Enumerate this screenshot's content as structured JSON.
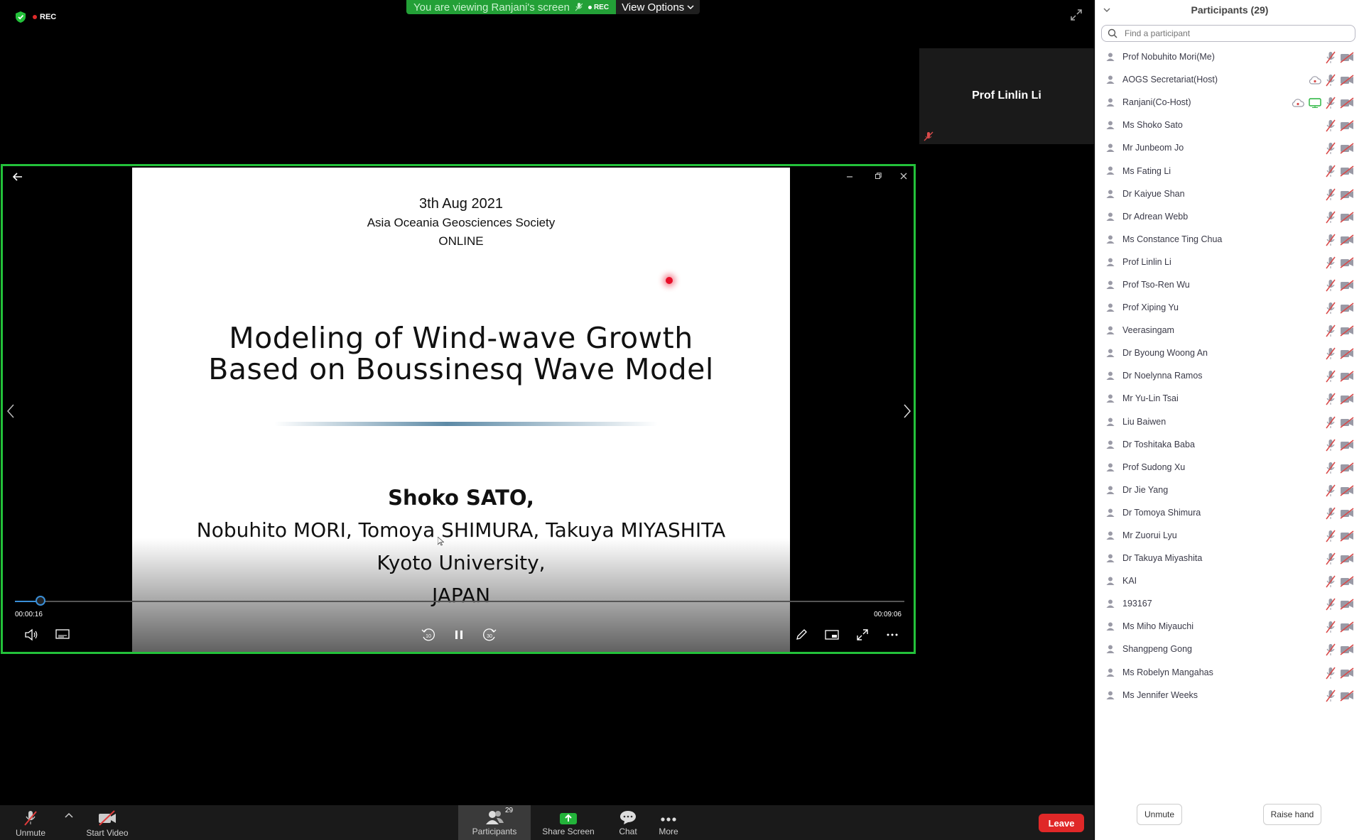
{
  "top_bar": {
    "rec_label": "REC",
    "viewing_text": "You are viewing Ranjani's screen",
    "banner_rec_label": "REC",
    "view_options_label": "View Options"
  },
  "thumbnail": {
    "name": "Prof Linlin Li"
  },
  "slide": {
    "date": "3th Aug 2021",
    "organization": "Asia Oceania Geosciences Society",
    "mode": "ONLINE",
    "title_line1": "Modeling of Wind-wave Growth",
    "title_line2": "Based on Boussinesq Wave Model",
    "presenter": "Shoko SATO,",
    "coauthors": "Nobuhito MORI, Tomoya SHIMURA, Takuya MIYASHITA",
    "university": "Kyoto University,",
    "country": "JAPAN"
  },
  "playback": {
    "current_time": "00:00:16",
    "total_time": "00:09:06",
    "progress": 0.029,
    "rewind_label": "10",
    "forward_label": "30"
  },
  "toolbar": {
    "unmute_label": "Unmute",
    "start_video_label": "Start Video",
    "participants_label": "Participants",
    "participants_count": "29",
    "share_screen_label": "Share Screen",
    "chat_label": "Chat",
    "more_label": "More",
    "leave_label": "Leave"
  },
  "panel": {
    "title": "Participants (29)",
    "search_placeholder": "Find a participant",
    "unmute_label": "Unmute",
    "raise_hand_label": "Raise hand",
    "participants": [
      {
        "name": "Prof Nobuhito Mori(Me)",
        "extra": ""
      },
      {
        "name": "AOGS Secretariat(Host)",
        "extra": "cloud"
      },
      {
        "name": "Ranjani(Co-Host)",
        "extra": "cloud-share"
      },
      {
        "name": "Ms Shoko Sato",
        "extra": ""
      },
      {
        "name": "Mr Junbeom Jo",
        "extra": ""
      },
      {
        "name": "Ms Fating Li",
        "extra": ""
      },
      {
        "name": "Dr Kaiyue Shan",
        "extra": ""
      },
      {
        "name": "Dr Adrean Webb",
        "extra": ""
      },
      {
        "name": "Ms Constance Ting Chua",
        "extra": ""
      },
      {
        "name": "Prof Linlin Li",
        "extra": ""
      },
      {
        "name": "Prof Tso-Ren Wu",
        "extra": ""
      },
      {
        "name": "Prof Xiping Yu",
        "extra": ""
      },
      {
        "name": "Veerasingam",
        "extra": ""
      },
      {
        "name": "Dr Byoung Woong An",
        "extra": ""
      },
      {
        "name": "Dr Noelynna Ramos",
        "extra": ""
      },
      {
        "name": "Mr Yu-Lin Tsai",
        "extra": ""
      },
      {
        "name": "Liu Baiwen",
        "extra": ""
      },
      {
        "name": "Dr Toshitaka Baba",
        "extra": ""
      },
      {
        "name": "Prof Sudong Xu",
        "extra": ""
      },
      {
        "name": "Dr Jie Yang",
        "extra": ""
      },
      {
        "name": "Dr Tomoya Shimura",
        "extra": ""
      },
      {
        "name": "Mr Zuorui Lyu",
        "extra": ""
      },
      {
        "name": "Dr Takuya Miyashita",
        "extra": ""
      },
      {
        "name": "KAI",
        "extra": ""
      },
      {
        "name": "193167",
        "extra": ""
      },
      {
        "name": "Ms Miho Miyauchi",
        "extra": ""
      },
      {
        "name": "Shangpeng Gong",
        "extra": ""
      },
      {
        "name": "Ms Robelyn Mangahas",
        "extra": ""
      },
      {
        "name": "Ms Jennifer Weeks",
        "extra": ""
      }
    ]
  },
  "colors": {
    "share_border": "#23c13a",
    "leave": "#e02828",
    "muted_icon": "#d94a4a",
    "progress": "#3a8fd8"
  }
}
